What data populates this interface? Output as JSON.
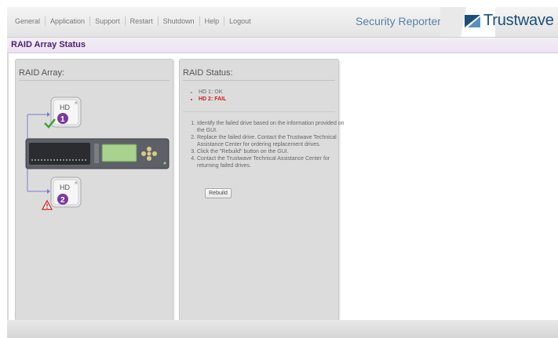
{
  "menu": {
    "items": [
      {
        "label": "General"
      },
      {
        "label": "Application"
      },
      {
        "label": "Support"
      },
      {
        "label": "Restart"
      },
      {
        "label": "Shutdown"
      },
      {
        "label": "Help"
      },
      {
        "label": "Logout"
      }
    ]
  },
  "header": {
    "app_title": "Security Reporter",
    "brand": "Trustwave",
    "brand_color": "#1b4f7a"
  },
  "page": {
    "title": "RAID Array Status"
  },
  "raid_array": {
    "title": "RAID Array:",
    "drives": [
      {
        "label": "HD",
        "number": "1",
        "badge_color": "#7c3a9c",
        "status_icon": "check-icon"
      },
      {
        "label": "HD",
        "number": "2",
        "badge_color": "#7c3a9c",
        "status_icon": "warning-icon"
      }
    ],
    "server_icon": "server-unit-icon"
  },
  "raid_status": {
    "title": "RAID Status:",
    "drive_status": [
      {
        "text": "HD 1: OK",
        "state": "ok"
      },
      {
        "text": "HD 2: FAIL",
        "state": "fail"
      }
    ],
    "instructions": [
      "Identify the failed drive based on the information provided on the GUI.",
      "Replace the failed drive. Contact the Trustwave Technical Assistance Center for ordering replacement drives.",
      "Click the \"Rebuild\" button on the GUI.",
      "Contact the Trustwave Technical Assistance Center for returning failed drives."
    ],
    "rebuild_label": "Rebuild"
  },
  "colors": {
    "ok": "#8a8a8a",
    "fail": "#d11b1b",
    "page_title": "#4b1e6e",
    "app_title": "#5a7fa8"
  }
}
